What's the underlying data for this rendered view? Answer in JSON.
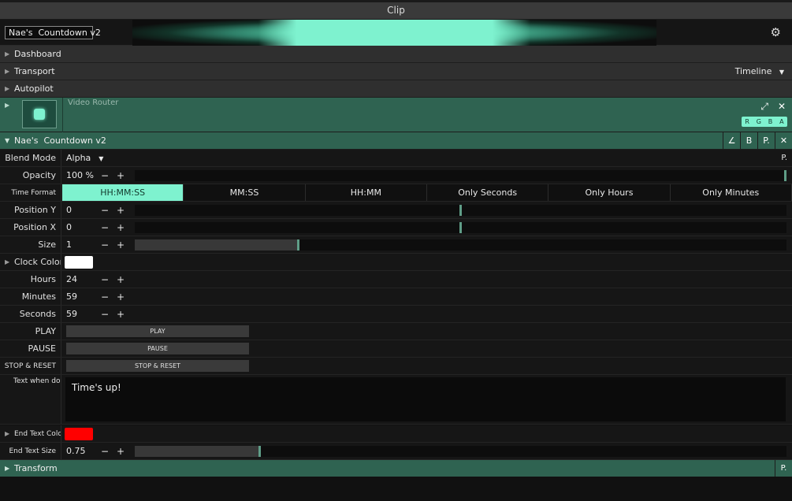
{
  "window": {
    "title": "Clip"
  },
  "clip": {
    "name": "Nae's  Countdown v2",
    "settings_icon": "gear-icon"
  },
  "sections": {
    "dashboard": "Dashboard",
    "transport": "Transport",
    "timeline": "Timeline",
    "autopilot": "Autopilot",
    "transform": "Transform"
  },
  "router": {
    "name": "Video Router",
    "channels": [
      "R",
      "G",
      "B",
      "A"
    ],
    "accent": "#7ef2cf"
  },
  "effect": {
    "name": "Nae's  Countdown v2",
    "buttons": [
      "∠",
      "B",
      "P.",
      "✕"
    ],
    "blend_mode": {
      "label": "Blend Mode",
      "value": "Alpha",
      "param_button": "P."
    },
    "opacity": {
      "label": "Opacity",
      "value": "100 %",
      "fraction": 1.0
    },
    "time_format": {
      "label": "Time Format",
      "options": [
        "HH:MM:SS",
        "MM:SS",
        "HH:MM",
        "Only Seconds",
        "Only Hours",
        "Only Minutes"
      ],
      "selected": "HH:MM:SS"
    },
    "position_y": {
      "label": "Position Y",
      "value": "0",
      "fraction": 0.5
    },
    "position_x": {
      "label": "Position X",
      "value": "0",
      "fraction": 0.5
    },
    "size": {
      "label": "Size",
      "value": "1",
      "fraction": 0.25
    },
    "clock_color": {
      "label": "Clock Color",
      "color": "#ffffff"
    },
    "hours": {
      "label": "Hours",
      "value": "24"
    },
    "minutes": {
      "label": "Minutes",
      "value": "59"
    },
    "seconds": {
      "label": "Seconds",
      "value": "59"
    },
    "play": {
      "label": "PLAY",
      "button": "PLAY"
    },
    "pause": {
      "label": "PAUSE",
      "button": "PAUSE"
    },
    "stop_reset": {
      "label": "STOP & RESET",
      "button": "STOP & RESET"
    },
    "text_when_done": {
      "label": "Text when done",
      "value": "Time's up!"
    },
    "end_text_color": {
      "label": "End Text Color",
      "color": "#ff0000"
    },
    "end_text_size": {
      "label": "End Text Size",
      "value": "0.75",
      "fraction": 0.19
    }
  },
  "transform_param_button": "P."
}
